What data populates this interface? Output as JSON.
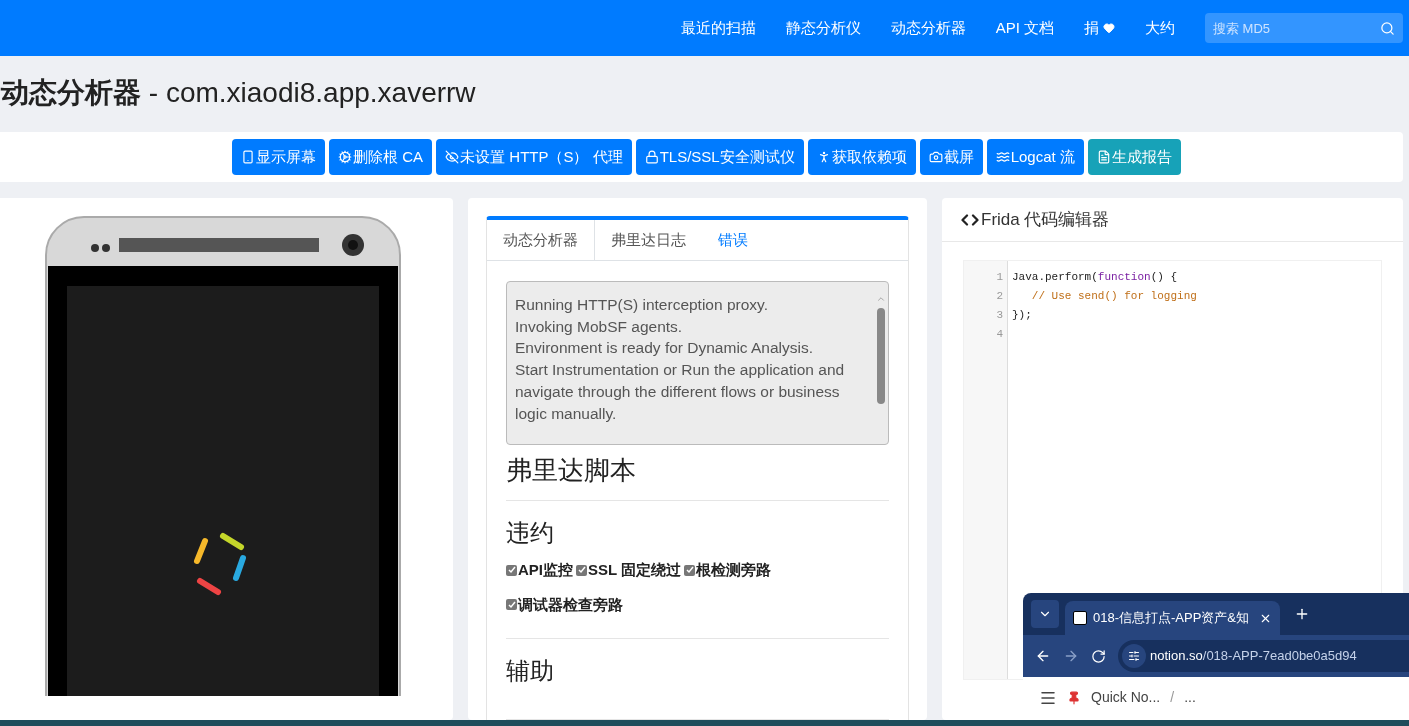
{
  "nav": {
    "items": [
      "最近的扫描",
      "静态分析仪",
      "动态分析器",
      "API 文档",
      "捐",
      "大约"
    ],
    "search": {
      "placeholder": "搜索 MD5"
    }
  },
  "page_title": "**动态分析器** - com.xiaodi8.app.xaverrw",
  "actions": [
    {
      "label": "显示屏幕",
      "kind": "primary"
    },
    {
      "label": "删除根 CA",
      "kind": "primary"
    },
    {
      "label": "未设置 HTTP（S） 代理",
      "kind": "primary"
    },
    {
      "label": "TLS/SSL安全测试仪",
      "kind": "primary"
    },
    {
      "label": "获取依赖项",
      "kind": "primary"
    },
    {
      "label": "截屏",
      "kind": "primary"
    },
    {
      "label": "Logcat 流",
      "kind": "primary"
    },
    {
      "label": "生成报告",
      "kind": "info"
    }
  ],
  "tabs": [
    {
      "label": "动态分析器",
      "selected": true,
      "kind": "plain"
    },
    {
      "label": "弗里达日志",
      "selected": false,
      "kind": "plain"
    },
    {
      "label": "错误",
      "selected": false,
      "kind": "link"
    }
  ],
  "log": "Running HTTP(S) interception proxy.\nInvoking MobSF agents.\nEnvironment is ready for Dynamic Analysis.\nStart Instrumentation or Run the application and navigate through the different flows or business logic manually.",
  "scripts_heading": "弗里达脚本",
  "sections": [
    {
      "title": "违约",
      "options": [
        {
          "label": "API监控",
          "checked": true
        },
        {
          "label": "SSL 固定绕过",
          "checked": true
        },
        {
          "label": "根检测旁路",
          "checked": true
        },
        {
          "label": "调试器检查旁路",
          "checked": true
        }
      ]
    },
    {
      "title": "辅助"
    }
  ],
  "editor": {
    "title": "Frida 代码编辑器",
    "lines": [
      {
        "number": "1",
        "segments": [
          {
            "text": "Java.perform(",
            "kind": "plain"
          },
          {
            "text": "function",
            "kind": "keyword"
          },
          {
            "text": "() {",
            "kind": "plain"
          }
        ]
      },
      {
        "number": "2",
        "segments": [
          {
            "text": "   // Use send() for logging",
            "kind": "comment"
          }
        ]
      },
      {
        "number": "3",
        "segments": [
          {
            "text": "});",
            "kind": "plain"
          }
        ]
      },
      {
        "number": "4"
      }
    ]
  },
  "browser": {
    "tab_title": "018-信息打点-APP资产&知",
    "address_host": "notion.so",
    "address_path": "/018-APP-7ead0be0a5d94",
    "breadcrumbs": [
      "Quick No...",
      "..."
    ],
    "separator": "/"
  }
}
